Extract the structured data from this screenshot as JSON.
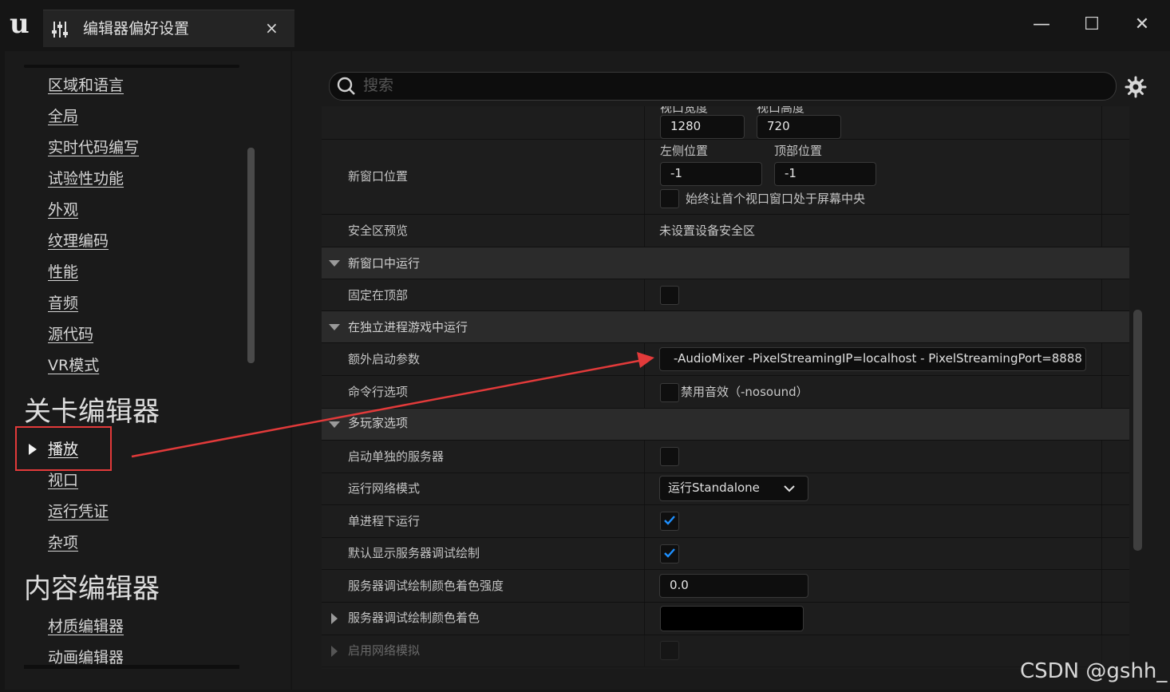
{
  "window": {
    "tab_title": "编辑器偏好设置",
    "close_tab": "×",
    "minimize": "—",
    "maximize": "☐",
    "close": "✕"
  },
  "sidebar": {
    "general_items": [
      "区域和语言",
      "全局",
      "实时代码编写",
      "试验性功能",
      "外观",
      "纹理编码",
      "性能",
      "音频",
      "源代码",
      "VR模式"
    ],
    "level_editor": {
      "title": "关卡编辑器",
      "items": [
        "播放",
        "视口",
        "运行凭证",
        "杂项"
      ],
      "selected": "播放"
    },
    "content_editor": {
      "title": "内容编辑器",
      "items": [
        "材质编辑器",
        "动画编辑器"
      ]
    }
  },
  "search": {
    "placeholder": "搜索"
  },
  "details": {
    "viewport_width_label": "视口宽度",
    "viewport_height_label": "视口高度",
    "viewport_width": "1280",
    "viewport_height": "720",
    "new_window_position": {
      "label": "新窗口位置",
      "left_label": "左侧位置",
      "top_label": "顶部位置",
      "left": "-1",
      "top": "-1",
      "center_label": "始终让首个视口窗口处于屏幕中央"
    },
    "safe_zone": {
      "label": "安全区预览",
      "value": "未设置设备安全区"
    },
    "cat_new_window": "新窗口中运行",
    "always_on_top": {
      "label": "固定在顶部"
    },
    "cat_standalone": "在独立进程游戏中运行",
    "extra_launch": {
      "label": "额外启动参数",
      "value": "-AudioMixer -PixelStreamingIP=localhost - PixelStreamingPort=8888"
    },
    "cmdline": {
      "label": "命令行选项",
      "option": "禁用音效（-nosound）"
    },
    "cat_multiplayer": "多玩家选项",
    "launch_server": {
      "label": "启动单独的服务器"
    },
    "net_mode": {
      "label": "运行网络模式",
      "value": "运行Standalone"
    },
    "single_process": {
      "label": "单进程下运行",
      "checked": true
    },
    "show_server_debug": {
      "label": "默认显示服务器调试绘制",
      "checked": true
    },
    "tint_strength": {
      "label": "服务器调试绘制颜色着色强度",
      "value": "0.0"
    },
    "tint_color": {
      "label": "服务器调试绘制颜色着色"
    },
    "net_emulation": {
      "label": "启用网络模拟"
    }
  },
  "watermark": "CSDN @gshh_",
  "colors": {
    "annotation": "#e23a3a",
    "checkmark": "#1e90ff"
  }
}
